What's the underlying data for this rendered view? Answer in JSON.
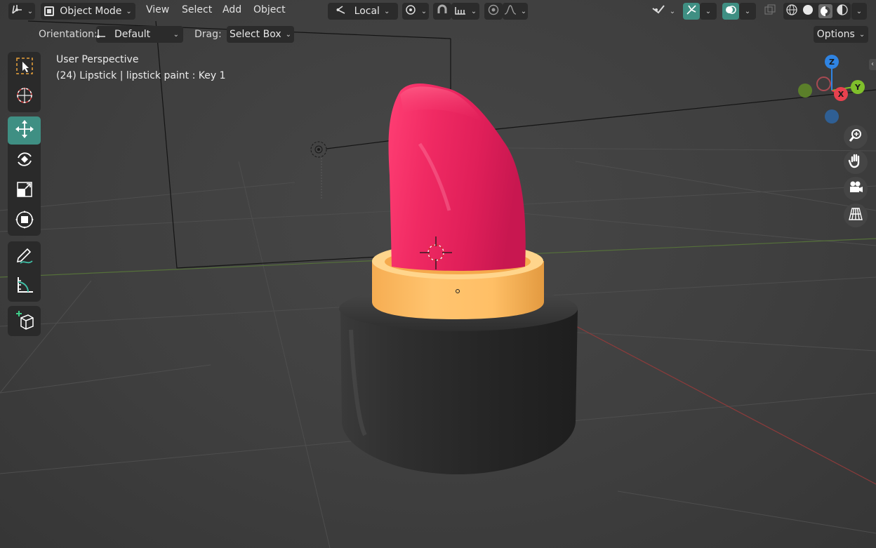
{
  "header": {
    "editor_type_icon": "axes-editor-icon",
    "mode": {
      "label": "Object Mode",
      "icon": "object-mode-icon"
    },
    "menus": [
      "View",
      "Select",
      "Add",
      "Object"
    ],
    "transform_orientation": {
      "label": "Local",
      "icon": "local-orientation-icon"
    },
    "pivot_icon": "pivot-point-icon",
    "snap_icon": "snap-magnet-icon",
    "snap_target_icon": "snap-increment-icon",
    "proportional_icon": "proportional-edit-icon",
    "falloff_icon": "falloff-curve-icon",
    "visibility_icon": "visibility-icon",
    "gizmo_icon": "gizmo-icon",
    "overlay_icon": "overlay-icon",
    "xray_icon": "xray-icon",
    "shading_icons": [
      "wireframe-shading-icon",
      "solid-shading-icon",
      "material-preview-icon",
      "rendered-shading-icon"
    ]
  },
  "tool_settings": {
    "orientation_label": "Orientation:",
    "orientation_value": "Default",
    "drag_label": "Drag:",
    "drag_value": "Select Box",
    "options_label": "Options"
  },
  "viewport": {
    "perspective": "User Perspective",
    "object_info": "(24) Lipstick | lipstick paint : Key 1"
  },
  "toolbar": [
    {
      "name": "select-box-tool",
      "icon": "select-box-icon",
      "active": false
    },
    {
      "name": "cursor-tool",
      "icon": "cursor-icon",
      "active": false
    },
    {
      "name": "move-tool",
      "icon": "move-icon",
      "active": true
    },
    {
      "name": "rotate-tool",
      "icon": "rotate-icon",
      "active": false
    },
    {
      "name": "scale-tool",
      "icon": "scale-icon",
      "active": false
    },
    {
      "name": "transform-tool",
      "icon": "transform-icon",
      "active": false
    },
    {
      "name": "annotate-tool",
      "icon": "annotate-icon",
      "active": false
    },
    {
      "name": "measure-tool",
      "icon": "measure-icon",
      "active": false
    },
    {
      "name": "add-cube-tool",
      "icon": "add-cube-icon",
      "active": false
    }
  ],
  "gizmo": {
    "x": "X",
    "y": "Y",
    "z": "Z"
  },
  "nav_buttons": [
    "zoom-icon",
    "hand-pan-icon",
    "camera-icon",
    "perspective-grid-icon"
  ],
  "colors": {
    "accent": "#3f8f83",
    "lipstick": "#e8245c",
    "collar": "#f8b55a",
    "base": "#2b2b2b",
    "axis_x": "#e8414e",
    "axis_y": "#7fbf2b",
    "axis_z": "#2f84e3"
  }
}
